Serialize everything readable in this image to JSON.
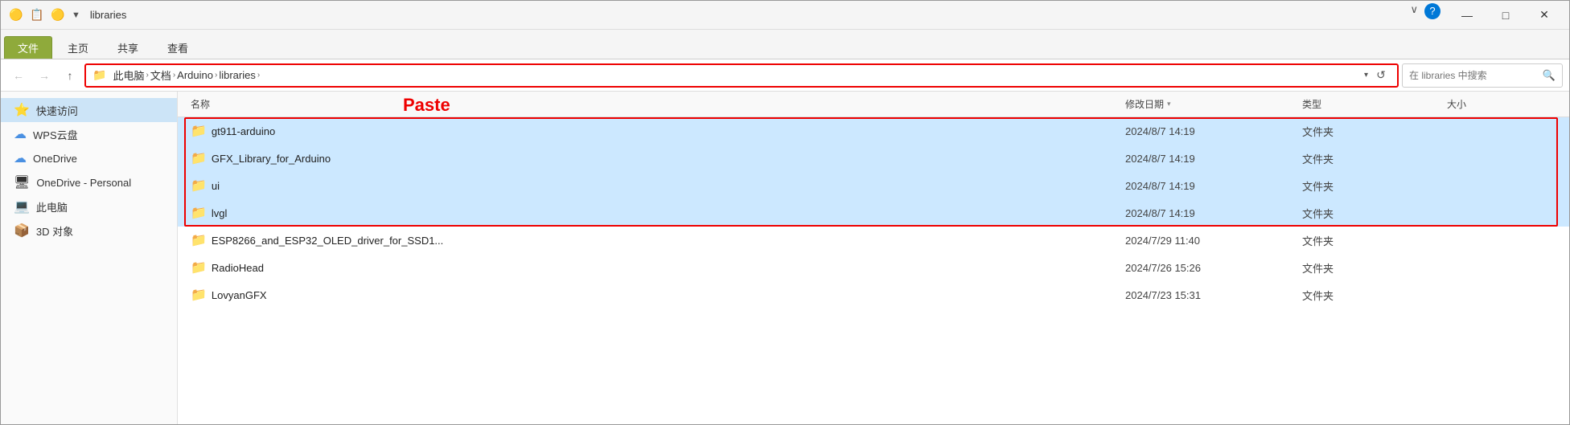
{
  "window": {
    "title": "libraries",
    "title_icon": "📁"
  },
  "titlebar": {
    "icons": [
      "🟡",
      "📋",
      "🟡"
    ],
    "minimize_label": "—",
    "maximize_label": "□",
    "close_label": "✕",
    "version_btn": "∨",
    "help_btn": "?"
  },
  "ribbon": {
    "tabs": [
      {
        "id": "file",
        "label": "文件",
        "active": true
      },
      {
        "id": "home",
        "label": "主页"
      },
      {
        "id": "share",
        "label": "共享"
      },
      {
        "id": "view",
        "label": "查看"
      }
    ]
  },
  "address": {
    "back_title": "后退",
    "forward_title": "前进",
    "up_title": "向上",
    "folder_icon": "📁",
    "segments": [
      {
        "text": "此电脑"
      },
      {
        "text": "文档"
      },
      {
        "text": "Arduino"
      },
      {
        "text": "libraries"
      }
    ],
    "refresh_icon": "↺",
    "search_placeholder": "在 libraries 中搜索",
    "search_icon": "🔍"
  },
  "paste_label": "Paste",
  "columns": [
    {
      "id": "name",
      "label": "名称"
    },
    {
      "id": "date",
      "label": "修改日期",
      "sort": true
    },
    {
      "id": "type",
      "label": "类型"
    },
    {
      "id": "size",
      "label": "大小"
    }
  ],
  "sidebar": {
    "items": [
      {
        "id": "quick-access",
        "label": "快速访问",
        "icon": "⭐",
        "active": false
      },
      {
        "id": "wps",
        "label": "WPS云盘",
        "icon": "☁"
      },
      {
        "id": "onedrive",
        "label": "OneDrive",
        "icon": "☁"
      },
      {
        "id": "onedrive-personal",
        "label": "OneDrive - Personal",
        "icon": "🖥"
      },
      {
        "id": "this-pc",
        "label": "此电脑",
        "icon": "💻"
      },
      {
        "id": "3d-objects",
        "label": "3D 对象",
        "icon": "📦"
      }
    ]
  },
  "files": [
    {
      "id": "gt911",
      "name": "gt911-arduino",
      "date": "2024/8/7 14:19",
      "type": "文件夹",
      "size": "",
      "highlighted": true,
      "selected": true
    },
    {
      "id": "gfx",
      "name": "GFX_Library_for_Arduino",
      "date": "2024/8/7 14:19",
      "type": "文件夹",
      "size": "",
      "highlighted": true,
      "selected": true
    },
    {
      "id": "ui",
      "name": "ui",
      "date": "2024/8/7 14:19",
      "type": "文件夹",
      "size": "",
      "highlighted": true,
      "selected": true
    },
    {
      "id": "lvgl",
      "name": "lvgl",
      "date": "2024/8/7 14:19",
      "type": "文件夹",
      "size": "",
      "highlighted": true,
      "selected": true
    },
    {
      "id": "esp",
      "name": "ESP8266_and_ESP32_OLED_driver_for_SSD1...",
      "date": "2024/7/29 11:40",
      "type": "文件夹",
      "size": "",
      "highlighted": false,
      "selected": false
    },
    {
      "id": "radiohead",
      "name": "RadioHead",
      "date": "2024/7/26 15:26",
      "type": "文件夹",
      "size": "",
      "highlighted": false,
      "selected": false
    },
    {
      "id": "lovyangfx",
      "name": "LovyanGFX",
      "date": "2024/7/23 15:31",
      "type": "文件夹",
      "size": "",
      "highlighted": false,
      "selected": false
    }
  ]
}
